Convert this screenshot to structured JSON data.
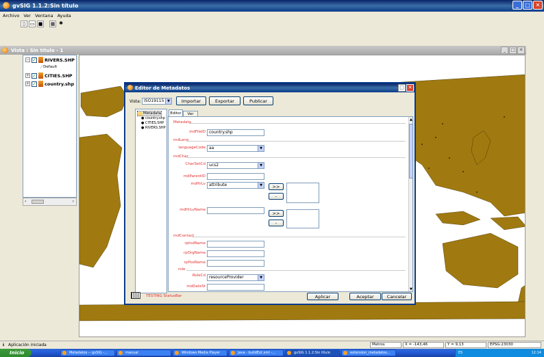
{
  "app": {
    "title": "gvSIG 1.1.2:Sin título"
  },
  "menu": [
    "Archivo",
    "Ver",
    "Ventana",
    "Ayuda"
  ],
  "toolbar": {
    "icons": [
      "new-icon",
      "open-icon",
      "save-icon",
      "view-icon",
      "tool-icon"
    ],
    "glyphs": [
      "▯",
      "▭",
      "■",
      "▦",
      "✱"
    ]
  },
  "vista": {
    "title": "Vista : Sin título - 1"
  },
  "toc": {
    "layers": [
      {
        "name": "RIVERS.SHP",
        "sub": "Default"
      },
      {
        "name": "CITIES.SHP"
      },
      {
        "name": "country.shp"
      }
    ]
  },
  "dialog": {
    "title": "Editor de Metadatos",
    "vista_label": "Vista:",
    "vista_value": "ISO19115",
    "buttons": {
      "importar": "Importar",
      "exportar": "Exportar",
      "publicar": "Publicar"
    },
    "tree": {
      "root": "Metadata",
      "items": [
        "country.shp",
        "CITIES.SHP",
        "RIVERS.SHP"
      ]
    },
    "tabs": [
      "Editor",
      "Ver XML"
    ],
    "sections": {
      "metadata": "Metadata",
      "mdLang": "mdLang",
      "mdChar": "mdChar",
      "mdContact": "mdContact",
      "role": "role"
    },
    "fields": {
      "mdFileID": {
        "label": "mdFileID",
        "value": "country.shp"
      },
      "languageCode": {
        "label": "languageCode",
        "value": "aa"
      },
      "CharSetCd": {
        "label": "CharSetCd",
        "value": "ucs2"
      },
      "mdParentID": {
        "label": "mdParentID",
        "value": ""
      },
      "mdHrLv": {
        "label": "mdHrLv",
        "value": "attribute"
      },
      "mdHrLvName": {
        "label": "mdHrLvName",
        "value": ""
      },
      "rpIndName": {
        "label": "rpIndName",
        "value": ""
      },
      "rpOrgName": {
        "label": "rpOrgName",
        "value": ""
      },
      "rpPosName": {
        "label": "rpPosName",
        "value": ""
      },
      "RoleCd": {
        "label": "RoleCd",
        "value": "resourceProvider"
      },
      "mdDateSt": {
        "label": "mdDateSt",
        "value": ""
      }
    },
    "add_label": ">>",
    "remove_label": "-",
    "status": "TESTING StatusBar",
    "footer": {
      "aplicar": "Aplicar",
      "aceptar": "Aceptar",
      "cancelar": "Cancelar"
    }
  },
  "statusbar": {
    "message": "Aplicación iniciada",
    "units": "Metros",
    "x": "X = -143,46",
    "y": "Y = 9,13",
    "epsg": "EPSG:23030"
  },
  "taskbar": {
    "start": "Inicio",
    "tasks": [
      "Metadatos -- gvSIG -...",
      "manual",
      "Windows Media Player",
      "Java - buildExt.xml -...",
      "gvSIG 1.1.2:Sin título",
      "extension_metadatos..."
    ],
    "lang": "ES",
    "clock": "12:14"
  },
  "colors": {
    "land": "#a07a10",
    "accent": "#e03030",
    "title": "#0a246a"
  }
}
